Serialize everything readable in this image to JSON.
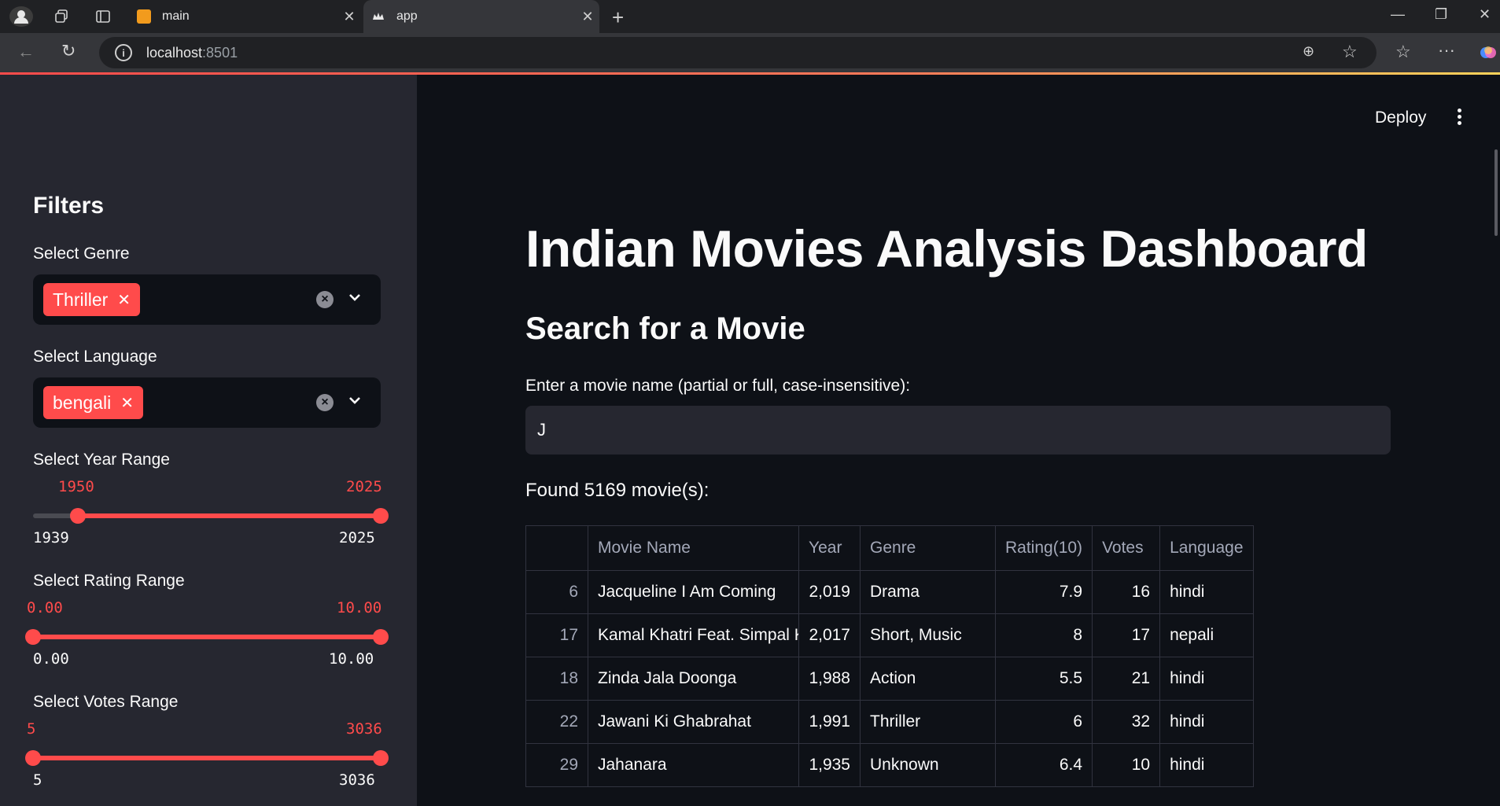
{
  "browser": {
    "tabs": [
      {
        "label": "main",
        "active": false
      },
      {
        "label": "app",
        "active": true
      }
    ],
    "url_host": "localhost",
    "url_port": ":8501"
  },
  "colors": {
    "accent": "#ff4b4b",
    "sidebar_bg": "#262730",
    "main_bg": "#0e1117"
  },
  "sidebar": {
    "heading": "Filters",
    "genre": {
      "label": "Select Genre",
      "selected": "Thriller"
    },
    "language": {
      "label": "Select Language",
      "selected": "bengali"
    },
    "year": {
      "label": "Select Year Range",
      "low": "1950",
      "high": "2025",
      "min": "1939",
      "max": "2025"
    },
    "rating": {
      "label": "Select Rating Range",
      "low": "0.00",
      "high": "10.00",
      "min": "0.00",
      "max": "10.00"
    },
    "votes": {
      "label": "Select Votes Range",
      "low": "5",
      "high": "3036",
      "min": "5",
      "max": "3036"
    }
  },
  "header": {
    "deploy_label": "Deploy"
  },
  "main": {
    "title": "Indian Movies Analysis Dashboard",
    "subtitle": "Search for a Movie",
    "search_label": "Enter a movie name (partial or full, case-insensitive):",
    "search_value": "J",
    "found_text": "Found 5169 movie(s):",
    "table": {
      "columns": [
        "",
        "Movie Name",
        "Year",
        "Genre",
        "Rating(10)",
        "Votes",
        "Language"
      ],
      "rows": [
        [
          "6",
          "Jacqueline I Am Coming",
          "2,019",
          "Drama",
          "7.9",
          "16",
          "hindi"
        ],
        [
          "17",
          "Kamal Khatri Feat. Simpal K",
          "2,017",
          "Short, Music",
          "8",
          "17",
          "nepali"
        ],
        [
          "18",
          "Zinda Jala Doonga",
          "1,988",
          "Action",
          "5.5",
          "21",
          "hindi"
        ],
        [
          "22",
          "Jawani Ki Ghabrahat",
          "1,991",
          "Thriller",
          "6",
          "32",
          "hindi"
        ],
        [
          "29",
          "Jahanara",
          "1,935",
          "Unknown",
          "6.4",
          "10",
          "hindi"
        ]
      ]
    }
  }
}
